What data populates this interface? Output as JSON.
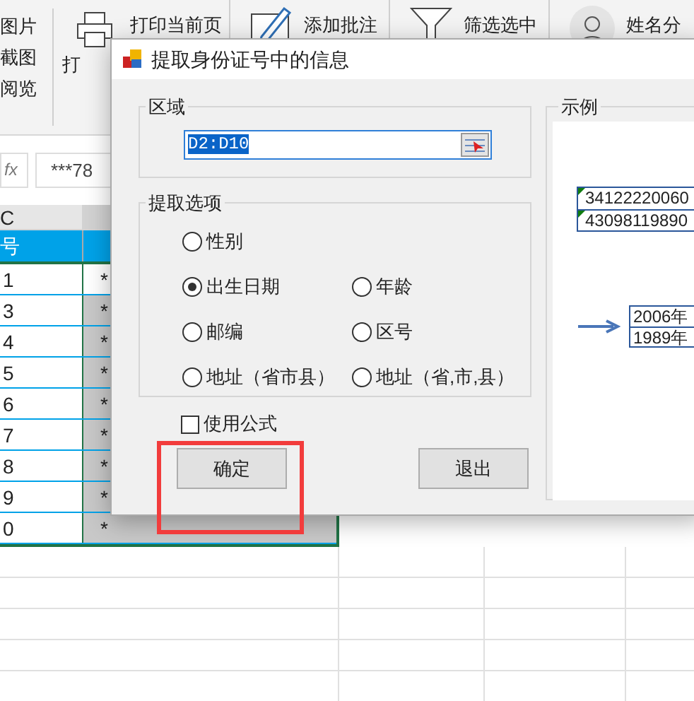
{
  "ribbon": {
    "left_items": [
      "图片",
      "截图",
      "阅览"
    ],
    "print_label": "打",
    "commands": [
      {
        "kind": "print",
        "label": "打印当前页"
      },
      {
        "kind": "comment",
        "label": "添加批注"
      },
      {
        "kind": "filter",
        "label": "筛选选中"
      },
      {
        "kind": "person",
        "label": "姓名分"
      }
    ]
  },
  "formula_bar": {
    "fx": "fx",
    "value": "***78"
  },
  "sheet": {
    "column_header": "C",
    "header_cell": "号",
    "rows": [
      {
        "c": "1",
        "d": "*",
        "shaded": false
      },
      {
        "c": "3",
        "d": "*",
        "shaded": true
      },
      {
        "c": "4",
        "d": "*",
        "shaded": true
      },
      {
        "c": "5",
        "d": "*",
        "shaded": true
      },
      {
        "c": "6",
        "d": "*",
        "shaded": true
      },
      {
        "c": "7",
        "d": "*",
        "shaded": true
      },
      {
        "c": "8",
        "d": "*",
        "shaded": true
      },
      {
        "c": "9",
        "d": "*",
        "shaded": true
      },
      {
        "c": "0",
        "d": "*",
        "shaded": true
      }
    ]
  },
  "dialog": {
    "title": "提取身份证号中的信息",
    "range_group": "区域",
    "range_value": "D2:D10",
    "options_group": "提取选项",
    "option_rows": [
      [
        {
          "label": "性别",
          "selected": false
        }
      ],
      [
        {
          "label": "出生日期",
          "selected": true
        },
        {
          "label": "年龄",
          "selected": false
        }
      ],
      [
        {
          "label": "邮编",
          "selected": false
        },
        {
          "label": "区号",
          "selected": false
        }
      ],
      [
        {
          "label": "地址（省市县）",
          "selected": false
        },
        {
          "label": "地址（省,市,县）",
          "selected": false
        }
      ]
    ],
    "use_formula": {
      "label": "使用公式",
      "checked": false
    },
    "buttons": [
      "确定",
      "退出"
    ],
    "example": {
      "title": "示例",
      "inputs": [
        "34122220060",
        "43098119890"
      ],
      "outputs": [
        "2006年",
        "1989年"
      ]
    }
  }
}
